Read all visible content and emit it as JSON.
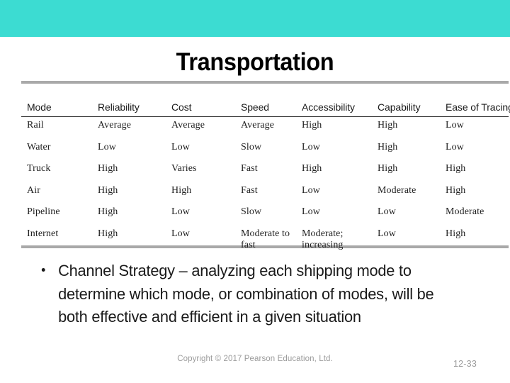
{
  "theme": {
    "banner_color": "#3cdcd2",
    "rule_color": "#a9a9a9",
    "text_color": "#1a1a1a",
    "footer_color": "#9b9b9b"
  },
  "slide": {
    "title": "Transportation"
  },
  "table": {
    "columns": [
      "Mode",
      "Reliability",
      "Cost",
      "Speed",
      "Accessibility",
      "Capability",
      "Ease of\nTracing"
    ],
    "rows": [
      {
        "mode": "Rail",
        "reliability": "Average",
        "cost": "Average",
        "speed": "Average",
        "accessibility": "High",
        "capability": "High",
        "ease_of_tracing": "Low"
      },
      {
        "mode": "Water",
        "reliability": "Low",
        "cost": "Low",
        "speed": "Slow",
        "accessibility": "Low",
        "capability": "High",
        "ease_of_tracing": "Low"
      },
      {
        "mode": "Truck",
        "reliability": "High",
        "cost": "Varies",
        "speed": "Fast",
        "accessibility": "High",
        "capability": "High",
        "ease_of_tracing": "High"
      },
      {
        "mode": "Air",
        "reliability": "High",
        "cost": "High",
        "speed": "Fast",
        "accessibility": "Low",
        "capability": "Moderate",
        "ease_of_tracing": "High"
      },
      {
        "mode": "Pipeline",
        "reliability": "High",
        "cost": "Low",
        "speed": "Slow",
        "accessibility": "Low",
        "capability": "Low",
        "ease_of_tracing": "Moderate"
      },
      {
        "mode": "Internet",
        "reliability": "High",
        "cost": "Low",
        "speed": "Moderate to fast",
        "accessibility": "Moderate; increasing",
        "capability": "Low",
        "ease_of_tracing": "High"
      }
    ]
  },
  "body": {
    "bullets": [
      "Channel Strategy – analyzing each shipping mode to determine which mode, or combination of modes, will be both effective and efficient in a given situation"
    ]
  },
  "footer": {
    "copyright": "Copyright © 2017 Pearson Education, Ltd.",
    "slide_number": "12-33"
  }
}
